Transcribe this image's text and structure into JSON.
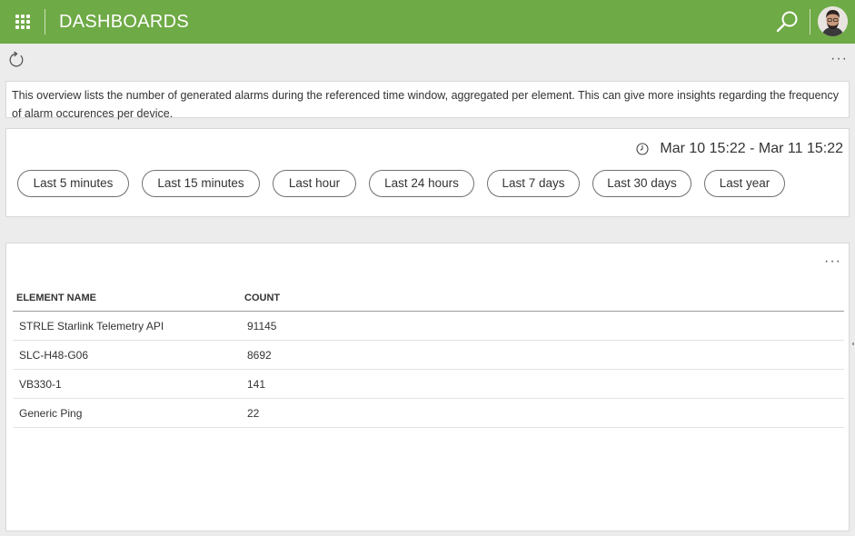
{
  "header": {
    "title": "DASHBOARDS",
    "accent_color": "#6eaa45",
    "apps_icon": "apps-grid-icon",
    "search_icon": "search-icon",
    "avatar": "user-avatar"
  },
  "toolbar": {
    "refresh_icon": "refresh-icon",
    "more_label": "···"
  },
  "description": {
    "text": "This overview lists the number of generated alarms during the referenced time window, aggregated per element. This can give more insights regarding the frequency of alarm occurences per device."
  },
  "time_filter": {
    "clock_icon": "clock-icon",
    "range_label": "Mar 10 15:22 - Mar 11 15:22",
    "presets": [
      "Last 5 minutes",
      "Last 15 minutes",
      "Last hour",
      "Last 24 hours",
      "Last 7 days",
      "Last 30 days",
      "Last year"
    ]
  },
  "table": {
    "more_label": "···",
    "columns": [
      "ELEMENT NAME",
      "COUNT"
    ],
    "rows": [
      {
        "name": "STRLE Starlink Telemetry API",
        "count": "91145"
      },
      {
        "name": "SLC-H48-G06",
        "count": "8692"
      },
      {
        "name": "VB330-1",
        "count": "141"
      },
      {
        "name": "Generic Ping",
        "count": "22"
      }
    ]
  }
}
